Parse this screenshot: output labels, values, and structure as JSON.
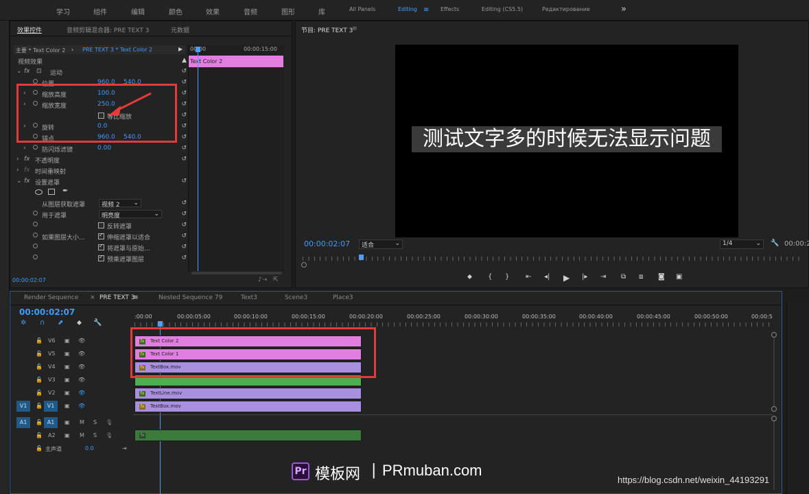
{
  "workspace": {
    "tabs": [
      "学习",
      "组件",
      "编辑",
      "颜色",
      "效果",
      "音频",
      "图形",
      "库",
      "All Panels",
      "Editing",
      "Effects",
      "Editing (CS5.5)",
      "Редактирование"
    ],
    "active": "Editing",
    "more": "»"
  },
  "effect_controls": {
    "tabs": [
      "效果控件",
      "音频剪辑混合器: PRE TEXT 3",
      "元数据"
    ],
    "master": "主要 * Text Color 2",
    "clip": "PRE TEXT 3 * Text Color 2",
    "section": "视频效果",
    "motion": "运动",
    "position_label": "位置",
    "position_x": "960.0",
    "position_y": "540.0",
    "scale_h_label": "缩放高度",
    "scale_h": "100.0",
    "scale_w_label": "缩放宽度",
    "scale_w": "250.0",
    "uniform_label": "等比缩放",
    "rotation_label": "旋转",
    "rotation": "0.0",
    "anchor_label": "锚点",
    "anchor_x": "960.0",
    "anchor_y": "540.0",
    "flicker_label": "防闪烁滤镜",
    "flicker": "0.00",
    "opacity": "不透明度",
    "timeremap": "时间重映射",
    "matte": "设置遮罩",
    "matte_from_label": "从图层获取遮罩",
    "matte_from": "视频 2",
    "use_label": "用于遮罩",
    "use": "明亮度",
    "invert": "反转遮罩",
    "ifsize": "如果图层大小...",
    "stretch": "伸缩遮罩以适合",
    "composite": "将遮罩与原始...",
    "premult": "预乘遮罩图层",
    "timecode": "00:00:02:07",
    "mini_ruler_start": "00:00",
    "mini_ruler_end": "00:00:15:00",
    "mini_clip": "Text Color 2"
  },
  "program": {
    "title": "节目: PRE TEXT 3",
    "subtitle": "测试文字多的时候无法显示问题",
    "timecode": "00:00:02:07",
    "fit": "适合",
    "quality": "1/4",
    "timecode_right": "00:00:2"
  },
  "timeline": {
    "tabs": [
      "Render Sequence",
      "PRE TEXT 3",
      "Nested Sequence 79",
      "Text3",
      "Scene3",
      "Place3"
    ],
    "close": "×",
    "menu": "≡",
    "timecode": "00:00:02:07",
    "ruler": [
      ":00:00",
      "00:00:05:00",
      "00:00:10:00",
      "00:00:15:00",
      "00:00:20:00",
      "00:00:25:00",
      "00:00:30:00",
      "00:00:35:00",
      "00:00:40:00",
      "00:00:45:00",
      "00:00:50:00",
      "00:00:5"
    ],
    "tracks": [
      {
        "name": "V6",
        "patch": ""
      },
      {
        "name": "V5",
        "patch": ""
      },
      {
        "name": "V4",
        "patch": ""
      },
      {
        "name": "V3",
        "patch": ""
      },
      {
        "name": "V2",
        "patch": ""
      },
      {
        "name": "V1",
        "patch": "V1"
      },
      {
        "name": "A1",
        "patch": "A1"
      },
      {
        "name": "A2",
        "patch": ""
      }
    ],
    "m": "M",
    "s": "S",
    "master": "主声道",
    "master_val": "0.0",
    "clips": [
      {
        "label": "Text Color 2",
        "color": "#e07fe0",
        "icon": "fx"
      },
      {
        "label": "Text Color 1",
        "color": "#e07fe0",
        "icon": "fx"
      },
      {
        "label": "TextBox.mov",
        "color": "#a88fe0",
        "icon": "fx"
      },
      {
        "label": "",
        "color": "#4cb050",
        "icon": ""
      },
      {
        "label": "TextLine.mov",
        "color": "#a88fe0",
        "icon": "fx"
      },
      {
        "label": "TextBox.mov",
        "color": "#a88fe0",
        "icon": "fx"
      }
    ]
  },
  "watermark": {
    "pr": "Pr",
    "brand": "模板网",
    "sep": "|",
    "site": "PRmuban.com"
  },
  "csdn": "https://blog.csdn.net/weixin_44193291",
  "colors": {
    "accent": "#3f9bff",
    "red": "#e23b3b",
    "pink": "#e07fe0",
    "lavender": "#a88fe0",
    "green": "#4cb050",
    "playhead": "#4a9fff"
  }
}
